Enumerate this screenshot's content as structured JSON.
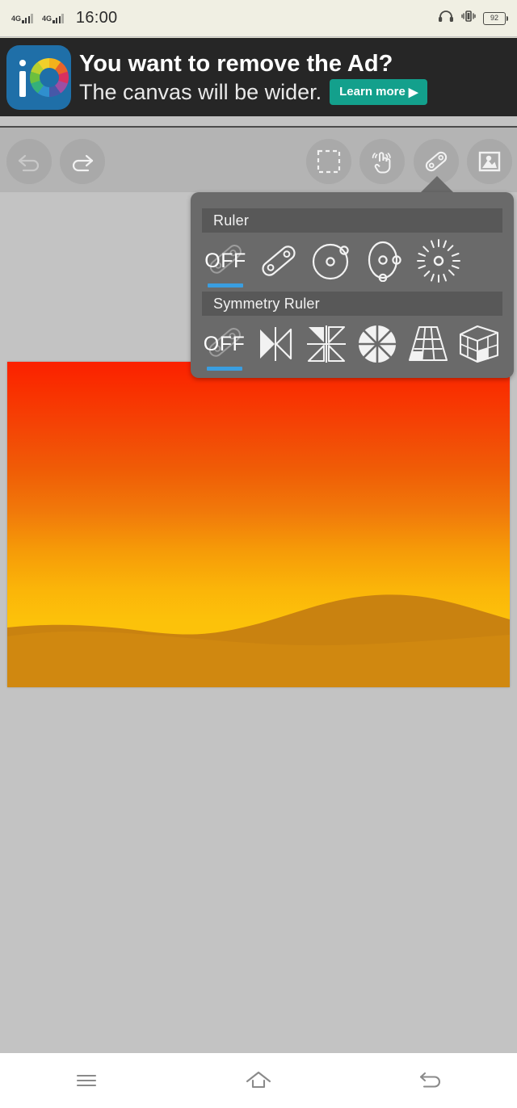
{
  "status_bar": {
    "network_labels": [
      "4G",
      "4G"
    ],
    "time": "16:00",
    "battery_level": "92",
    "icons": [
      "signal-4g-icon",
      "signal-4g-icon",
      "headphones-icon",
      "vibrate-icon",
      "battery-icon"
    ]
  },
  "ad": {
    "headline": "You want to remove the Ad?",
    "subline": "The canvas will be wider.",
    "cta_label": "Learn more",
    "cta_arrow": "▶",
    "logo_name": "ibispaint-logo",
    "bg_color": "#262626",
    "cta_color": "#13a08c"
  },
  "toolbar": {
    "buttons": [
      {
        "name": "undo-button",
        "label": "Undo",
        "enabled": false
      },
      {
        "name": "redo-button",
        "label": "Redo",
        "enabled": true
      },
      {
        "name": "selection-tool-button",
        "label": "Selection",
        "enabled": true
      },
      {
        "name": "transform-hand-button",
        "label": "Hand / Gesture",
        "enabled": true
      },
      {
        "name": "ruler-tool-button",
        "label": "Ruler",
        "enabled": true,
        "active": true
      },
      {
        "name": "photo-import-button",
        "label": "Photo",
        "enabled": true
      }
    ],
    "bg_color": "#b4b4b4"
  },
  "popup": {
    "bg_color": "#6a6a6a",
    "header_color": "#585858",
    "selected_underline_color": "#3a9ee0",
    "sections": [
      {
        "title": "Ruler",
        "options": [
          {
            "label": "OFF",
            "name": "ruler-off-option",
            "selected": true
          },
          {
            "label": "",
            "name": "ruler-line-option",
            "selected": false
          },
          {
            "label": "",
            "name": "ruler-circle-option",
            "selected": false
          },
          {
            "label": "",
            "name": "ruler-ellipse-option",
            "selected": false
          },
          {
            "label": "",
            "name": "ruler-radial-option",
            "selected": false
          }
        ]
      },
      {
        "title": "Symmetry Ruler",
        "options": [
          {
            "label": "OFF",
            "name": "symmetry-off-option",
            "selected": true
          },
          {
            "label": "",
            "name": "symmetry-mirror-option",
            "selected": false
          },
          {
            "label": "",
            "name": "symmetry-quad-option",
            "selected": false
          },
          {
            "label": "",
            "name": "symmetry-radial-option",
            "selected": false
          },
          {
            "label": "",
            "name": "symmetry-perspective-option",
            "selected": false
          },
          {
            "label": "",
            "name": "symmetry-isometric-option",
            "selected": false
          }
        ]
      }
    ]
  },
  "canvas": {
    "artwork_description": "Sunset desert landscape",
    "sky_top_color": "#fb2000",
    "sky_bottom_color": "#fbc40b",
    "dune_color": "#d08810",
    "dune_shadow_color": "#c37d0c",
    "background_color": "#c3c3c3"
  },
  "nav_bar": {
    "buttons": [
      {
        "name": "recents-button",
        "label": "Recents"
      },
      {
        "name": "home-button",
        "label": "Home"
      },
      {
        "name": "back-button",
        "label": "Back"
      }
    ],
    "bg_color": "#ffffff"
  }
}
